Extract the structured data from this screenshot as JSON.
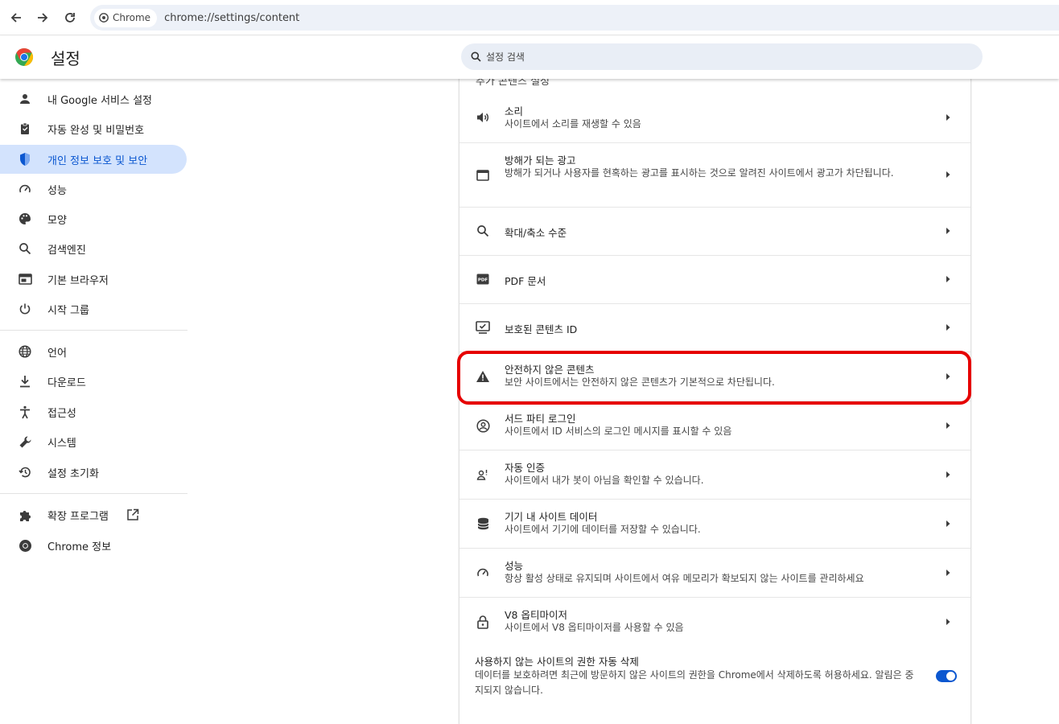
{
  "browser": {
    "chip_label": "Chrome",
    "url": "chrome://settings/content"
  },
  "header": {
    "title": "설정",
    "search_placeholder": "설정 검색"
  },
  "sidebar": {
    "items": [
      {
        "label": "내 Google 서비스 설정",
        "icon": "person-icon"
      },
      {
        "label": "자동 완성 및 비밀번호",
        "icon": "clipboard-icon"
      },
      {
        "label": "개인 정보 보호 및 보안",
        "icon": "shield-icon",
        "active": true
      },
      {
        "label": "성능",
        "icon": "speedometer-icon"
      },
      {
        "label": "모양",
        "icon": "palette-icon"
      },
      {
        "label": "검색엔진",
        "icon": "search-icon"
      },
      {
        "label": "기본 브라우저",
        "icon": "browser-icon"
      },
      {
        "label": "시작 그룹",
        "icon": "power-icon"
      },
      {
        "label": "언어",
        "icon": "globe-icon"
      },
      {
        "label": "다운로드",
        "icon": "download-icon"
      },
      {
        "label": "접근성",
        "icon": "accessibility-icon"
      },
      {
        "label": "시스템",
        "icon": "wrench-icon"
      },
      {
        "label": "설정 초기화",
        "icon": "history-icon"
      },
      {
        "label": "확장 프로그램",
        "icon": "puzzle-icon"
      },
      {
        "label": "Chrome 정보",
        "icon": "chrome-icon"
      }
    ]
  },
  "content": {
    "cut_title": "추가 콘텐츠 설정",
    "rows": [
      {
        "title": "소리",
        "subtitle": "사이트에서 소리를 재생할 수 있음",
        "icon": "speaker-icon"
      },
      {
        "title": "방해가 되는 광고",
        "subtitle": "방해가 되거나 사용자를 현혹하는 광고를 표시하는 것으로 알려진 사이트에서 광고가 차단됩니다.",
        "icon": "window-icon"
      },
      {
        "title": "확대/축소 수준",
        "subtitle": "",
        "icon": "zoom-icon"
      },
      {
        "title": "PDF 문서",
        "subtitle": "",
        "icon": "pdf-icon"
      },
      {
        "title": "보호된 콘텐츠 ID",
        "subtitle": "",
        "icon": "protected-content-icon"
      },
      {
        "title": "안전하지 않은 콘텐츠",
        "subtitle": "보안 사이트에서는 안전하지 않은 콘텐츠가 기본적으로 차단됩니다.",
        "icon": "warning-icon"
      },
      {
        "title": "서드 파티 로그인",
        "subtitle": "사이트에서 ID 서비스의 로그인 메시지를 표시할 수 있음",
        "icon": "account-circle-icon"
      },
      {
        "title": "자동 인증",
        "subtitle": "사이트에서 내가 봇이 아님을 확인할 수 있습니다.",
        "icon": "person-check-icon"
      },
      {
        "title": "기기 내 사이트 데이터",
        "subtitle": "사이트에서 기기에 데이터를 저장할 수 있습니다.",
        "icon": "database-icon"
      },
      {
        "title": "성능",
        "subtitle": "항상 활성 상태로 유지되며 사이트에서 여유 메모리가 확보되지 않는 사이트를 관리하세요",
        "icon": "speedometer-icon"
      },
      {
        "title": "V8 옵티마이저",
        "subtitle": "사이트에서 V8 옵티마이저를 사용할 수 있음",
        "icon": "lock-icon"
      }
    ],
    "auto_revoke": {
      "title": "사용하지 않는 사이트의 권한 자동 삭제",
      "subtitle": "데이터를 보호하려면 최근에 방문하지 않은 사이트의 권한을 Chrome에서 삭제하도록 허용하세요. 알림은 중지되지 않습니다.",
      "enabled": true
    }
  },
  "colors": {
    "accent": "#0b57d0",
    "active_bg": "#d3e3fd",
    "highlight": "#e60000"
  }
}
